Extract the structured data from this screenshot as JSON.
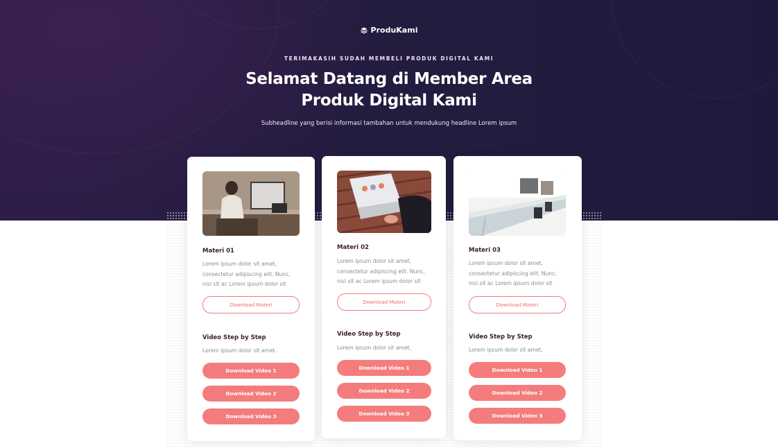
{
  "brand": {
    "name": "ProduKami",
    "icon": "layers-icon"
  },
  "hero": {
    "eyebrow": "TERIMAKASIH SUDAH MEMBELI PRODUK DIGITAL KAMI",
    "headline_line1": "Selamat Datang di Member Area",
    "headline_line2": "Produk Digital Kami",
    "subheadline": "Subheadline yang berisi informasi tambahan untuk mendukung headline Lorem ipsum"
  },
  "cards": [
    {
      "title": "Materi 01",
      "description": "Lorem ipsum dolor sit amet, consectetur adipiscing elit. Nunc, nisl sit ac Lorem ipsum dolor sit",
      "download_label": "Download Materi",
      "video_title": "Video Step by Step",
      "video_desc": "Lorem ipsum dolor sit amet.",
      "videos": [
        "Download Video 1",
        "Download Video 2",
        "Download Video 3"
      ]
    },
    {
      "title": "Materi 02",
      "description": "Lorem ipsum dolor sit amet, consectetur adipiscing elit. Nunc, nisl sit ac Lorem ipsum dolor sit",
      "download_label": "Download Materi",
      "video_title": "Video Step by Step",
      "video_desc": "Lorem ipsum dolor sit amet.",
      "videos": [
        "Download Video 1",
        "Download Video 2",
        "Download Video 3"
      ]
    },
    {
      "title": "Materi 03",
      "description": "Lorem ipsum dolor sit amet, consectetur adipiscing elit. Nunc, nisl sit ac Lorem ipsum dolor sit",
      "download_label": "Download Materi",
      "video_title": "Video Step by Step",
      "video_desc": "Lorem ipsum dolor sit amet.",
      "videos": [
        "Download Video 1",
        "Download Video 2",
        "Download Video 3"
      ]
    }
  ],
  "colors": {
    "hero_bg": "#231c3f",
    "accent": "#f47c7c",
    "heading": "#3a1d2e",
    "body_text": "#8a8a8a"
  }
}
